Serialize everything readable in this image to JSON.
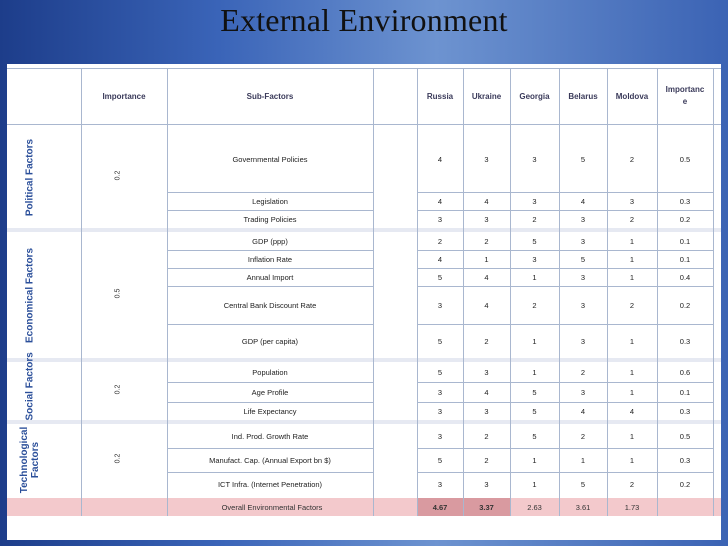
{
  "slide": {
    "title": "External Environment"
  },
  "table": {
    "headers": {
      "importance": "Importance",
      "subfactors": "Sub-Factors",
      "countries": [
        "Russia",
        "Ukraine",
        "Georgia",
        "Belarus",
        "Moldova"
      ],
      "importance2": "Importanc\ne"
    },
    "groups": [
      {
        "name": "Political Factors",
        "importance": "0.2",
        "rows": [
          {
            "sub": "Governmental Policies",
            "values": [
              "4",
              "3",
              "3",
              "5",
              "2"
            ],
            "weight": "0.5"
          },
          {
            "sub": "Legislation",
            "values": [
              "4",
              "4",
              "3",
              "4",
              "3"
            ],
            "weight": "0.3"
          },
          {
            "sub": "Trading Policies",
            "values": [
              "3",
              "3",
              "2",
              "3",
              "2"
            ],
            "weight": "0.2"
          }
        ]
      },
      {
        "name": "Economical Factors",
        "importance": "0.5",
        "rows": [
          {
            "sub": "GDP (ppp)",
            "values": [
              "2",
              "2",
              "5",
              "3",
              "1"
            ],
            "weight": "0.1"
          },
          {
            "sub": "Inflation Rate",
            "values": [
              "4",
              "1",
              "3",
              "5",
              "1"
            ],
            "weight": "0.1"
          },
          {
            "sub": "Annual Import",
            "values": [
              "5",
              "4",
              "1",
              "3",
              "1"
            ],
            "weight": "0.4"
          },
          {
            "sub": "Central Bank Discount Rate",
            "values": [
              "3",
              "4",
              "2",
              "3",
              "2"
            ],
            "weight": "0.2"
          },
          {
            "sub": "GDP (per capita)",
            "values": [
              "5",
              "2",
              "1",
              "3",
              "1"
            ],
            "weight": "0.3"
          }
        ]
      },
      {
        "name": "Social Factors",
        "importance": "0.2",
        "rows": [
          {
            "sub": "Population",
            "values": [
              "5",
              "3",
              "1",
              "2",
              "1"
            ],
            "weight": "0.6"
          },
          {
            "sub": "Age Profile",
            "values": [
              "3",
              "4",
              "5",
              "3",
              "1"
            ],
            "weight": "0.1"
          },
          {
            "sub": "Life Expectancy",
            "values": [
              "3",
              "3",
              "5",
              "4",
              "4"
            ],
            "weight": "0.3"
          }
        ]
      },
      {
        "name": "Technological\nFactors",
        "importance": "0.2",
        "rows": [
          {
            "sub": "Ind. Prod. Growth Rate",
            "values": [
              "3",
              "2",
              "5",
              "2",
              "1"
            ],
            "weight": "0.5"
          },
          {
            "sub": "Manufact. Cap. (Annual Export bn $)",
            "values": [
              "5",
              "2",
              "1",
              "1",
              "1"
            ],
            "weight": "0.3"
          },
          {
            "sub": "ICT Infra. (Internet Penetration)",
            "values": [
              "3",
              "3",
              "1",
              "5",
              "2"
            ],
            "weight": "0.2"
          }
        ]
      }
    ],
    "total": {
      "label": "Overall Environmental Factors",
      "values": [
        "4.67",
        "3.37",
        "2.63",
        "3.61",
        "1.73"
      ]
    }
  },
  "colors": {
    "total_highlight": "#f3c9cc",
    "strong_total_cells": "#d99aa0",
    "category_text": "#2b4f9a"
  }
}
